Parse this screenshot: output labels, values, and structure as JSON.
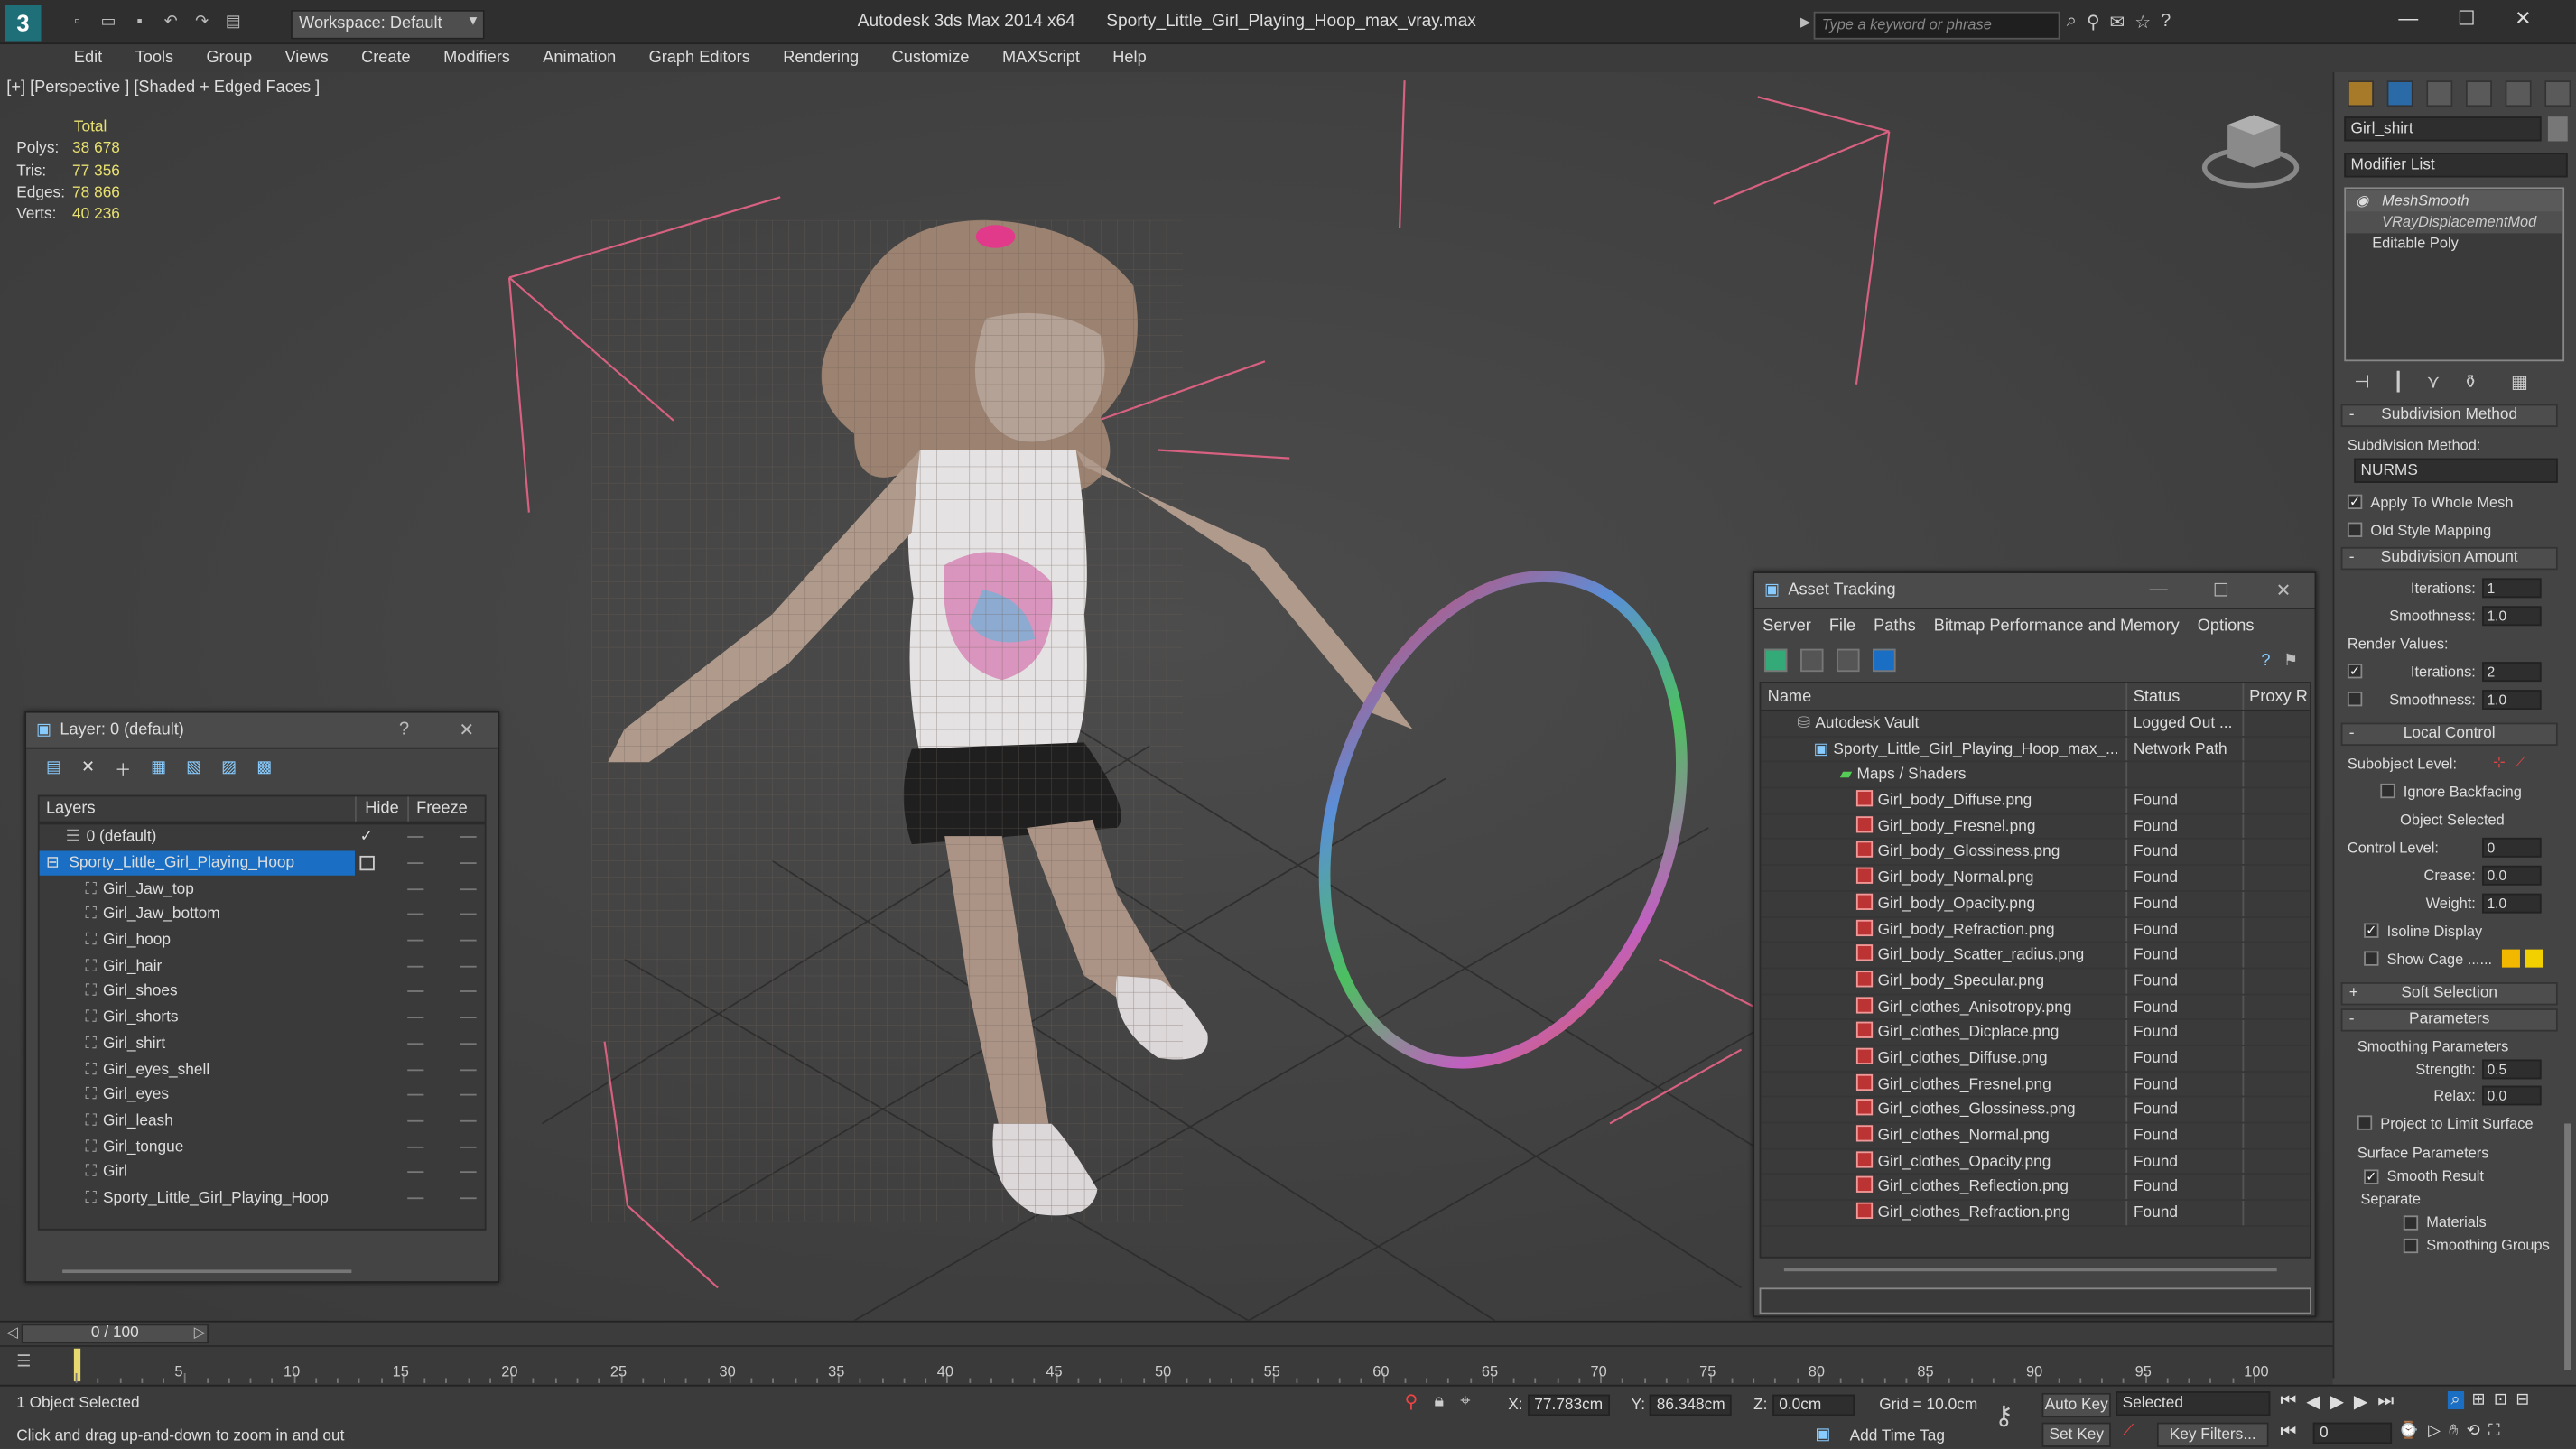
{
  "app": {
    "title": "Autodesk 3ds Max  2014 x64",
    "file": "Sporty_Little_Girl_Playing_Hoop_max_vray.max",
    "workspace": "Workspace: Default",
    "search_placeholder": "Type a keyword or phrase"
  },
  "menu": [
    "Edit",
    "Tools",
    "Group",
    "Views",
    "Create",
    "Modifiers",
    "Animation",
    "Graph Editors",
    "Rendering",
    "Customize",
    "MAXScript",
    "Help"
  ],
  "viewport": {
    "label": "[+] [Perspective ] [Shaded + Edged Faces ]",
    "stats": {
      "total_label": "Total",
      "rows": [
        {
          "k": "Polys:",
          "v": "38 678"
        },
        {
          "k": "Tris:",
          "v": "77 356"
        },
        {
          "k": "Edges:",
          "v": "78 866"
        },
        {
          "k": "Verts:",
          "v": "40 236"
        }
      ]
    }
  },
  "layers": {
    "title": "Layer: 0 (default)",
    "col_layers": "Layers",
    "col_hide": "Hide",
    "col_freeze": "Freeze",
    "rows": [
      "0 (default)",
      "Sporty_Little_Girl_Playing_Hoop",
      "Girl_Jaw_top",
      "Girl_Jaw_bottom",
      "Girl_hoop",
      "Girl_hair",
      "Girl_shoes",
      "Girl_shorts",
      "Girl_shirt",
      "Girl_eyes_shell",
      "Girl_eyes",
      "Girl_leash",
      "Girl_tongue",
      "Girl",
      "Sporty_Little_Girl_Playing_Hoop"
    ]
  },
  "asset": {
    "title": "Asset Tracking",
    "menu": [
      "Server",
      "File",
      "Paths",
      "Bitmap Performance and Memory",
      "Options"
    ],
    "col_name": "Name",
    "col_status": "Status",
    "col_proxy": "Proxy R",
    "rows": [
      {
        "name": "Autodesk Vault",
        "status": "Logged Out ..."
      },
      {
        "name": "Sporty_Little_Girl_Playing_Hoop_max_...",
        "status": "Network Path"
      },
      {
        "name": "Maps / Shaders",
        "status": ""
      },
      {
        "name": "Girl_body_Diffuse.png",
        "status": "Found"
      },
      {
        "name": "Girl_body_Fresnel.png",
        "status": "Found"
      },
      {
        "name": "Girl_body_Glossiness.png",
        "status": "Found"
      },
      {
        "name": "Girl_body_Normal.png",
        "status": "Found"
      },
      {
        "name": "Girl_body_Opacity.png",
        "status": "Found"
      },
      {
        "name": "Girl_body_Refraction.png",
        "status": "Found"
      },
      {
        "name": "Girl_body_Scatter_radius.png",
        "status": "Found"
      },
      {
        "name": "Girl_body_Specular.png",
        "status": "Found"
      },
      {
        "name": "Girl_clothes_Anisotropy.png",
        "status": "Found"
      },
      {
        "name": "Girl_clothes_Dicplace.png",
        "status": "Found"
      },
      {
        "name": "Girl_clothes_Diffuse.png",
        "status": "Found"
      },
      {
        "name": "Girl_clothes_Fresnel.png",
        "status": "Found"
      },
      {
        "name": "Girl_clothes_Glossiness.png",
        "status": "Found"
      },
      {
        "name": "Girl_clothes_Normal.png",
        "status": "Found"
      },
      {
        "name": "Girl_clothes_Opacity.png",
        "status": "Found"
      },
      {
        "name": "Girl_clothes_Reflection.png",
        "status": "Found"
      },
      {
        "name": "Girl_clothes_Refraction.png",
        "status": "Found"
      }
    ]
  },
  "cmd": {
    "object_name": "Girl_shirt",
    "modifier_list": "Modifier List",
    "stack": [
      "MeshSmooth",
      "VRayDisplacementMod",
      "Editable Poly"
    ],
    "subdiv_method_title": "Subdivision Method",
    "subdiv_method_label": "Subdivision Method:",
    "subdiv_method_value": "NURMS",
    "apply_whole": "Apply To Whole Mesh",
    "old_style": "Old Style Mapping",
    "subdiv_amount_title": "Subdivision Amount",
    "iterations_label": "Iterations:",
    "iterations_value": "1",
    "smoothness_label": "Smoothness:",
    "smoothness_value": "1.0",
    "render_values": "Render Values:",
    "r_iterations_value": "2",
    "r_smoothness_value": "1.0",
    "local_control_title": "Local Control",
    "subobject_level": "Subobject Level:",
    "ignore_backfacing": "Ignore Backfacing",
    "object_selected": "Object Selected",
    "control_level_label": "Control Level:",
    "control_level_value": "0",
    "crease_label": "Crease:",
    "crease_value": "0.0",
    "weight_label": "Weight:",
    "weight_value": "1.0",
    "isoline": "Isoline Display",
    "show_cage": "Show Cage ......",
    "soft_selection": "Soft Selection",
    "parameters": "Parameters",
    "smoothing_params": "Smoothing Parameters",
    "strength_label": "Strength:",
    "strength_value": "0.5",
    "relax_label": "Relax:",
    "relax_value": "0.0",
    "project_limit": "Project to Limit Surface",
    "surface_params": "Surface Parameters",
    "smooth_result": "Smooth Result",
    "separate": "Separate",
    "materials": "Materials",
    "smoothing_groups": "Smoothing Groups"
  },
  "timeline": {
    "frame": "0 / 100",
    "ticks": [
      "0",
      "5",
      "10",
      "15",
      "20",
      "25",
      "30",
      "35",
      "40",
      "45",
      "50",
      "55",
      "60",
      "65",
      "70",
      "75",
      "80",
      "85",
      "90",
      "95",
      "100"
    ]
  },
  "status": {
    "selected": "1 Object Selected",
    "prompt": "Click and drag up-and-down to zoom in and out",
    "x_label": "X:",
    "x": "77.783cm",
    "y_label": "Y:",
    "y": "86.348cm",
    "z_label": "Z:",
    "z": "0.0cm",
    "grid": "Grid = 10.0cm",
    "add_time_tag": "Add Time Tag",
    "auto_key": "Auto Key",
    "set_key": "Set Key",
    "selected_dd": "Selected",
    "key_filters": "Key Filters...",
    "frame_field": "0"
  },
  "colors": {
    "accent": "#1a6fc4",
    "found_icon": "#b33333",
    "stats": "#e8e070"
  }
}
